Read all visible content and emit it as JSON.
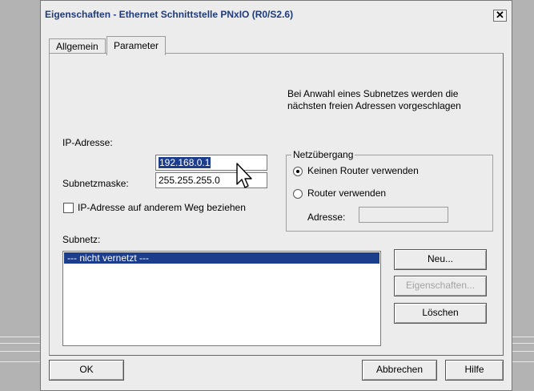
{
  "window": {
    "title": "Eigenschaften - Ethernet Schnittstelle  PNxIO (R0/S2.6)",
    "close_label": "✕"
  },
  "tabs": [
    {
      "label": "Allgemein",
      "active": false
    },
    {
      "label": "Parameter",
      "active": true
    }
  ],
  "hint": "Bei Anwahl eines Subnetzes werden die nächsten freien Adressen vorgeschlagen",
  "ip": {
    "label": "IP-Adresse:",
    "value": "192.168.0.1"
  },
  "subnet_mask": {
    "label": "Subnetzmaske:",
    "value": "255.255.255.0"
  },
  "ip_other_way": {
    "label": "IP-Adresse auf anderem Weg beziehen",
    "checked": false
  },
  "gateway": {
    "title": "Netzübergang",
    "options": [
      {
        "label": "Keinen Router verwenden",
        "selected": true
      },
      {
        "label": "Router verwenden",
        "selected": false
      }
    ],
    "address_label": "Adresse:",
    "address_value": ""
  },
  "subnet": {
    "label": "Subnetz:",
    "items": [
      "--- nicht vernetzt ---"
    ],
    "selected_index": 0
  },
  "buttons": {
    "new": "Neu...",
    "properties": "Eigenschaften...",
    "delete": "Löschen",
    "ok": "OK",
    "cancel": "Abbrechen",
    "help": "Hilfe"
  },
  "colors": {
    "selection": "#1c3c8c",
    "title_text": "#1f3a7a",
    "dialog_bg": "#ececec"
  }
}
